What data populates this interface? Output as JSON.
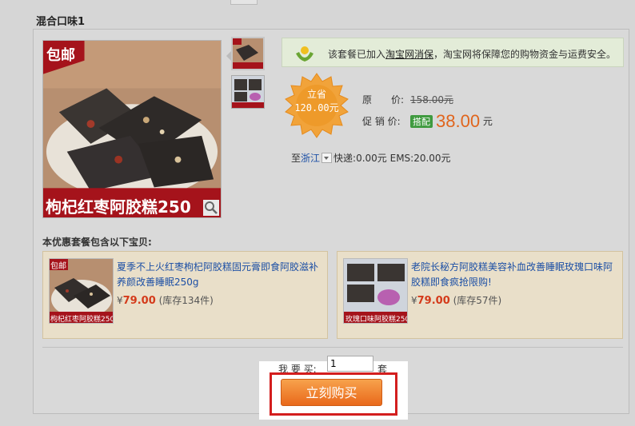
{
  "package": {
    "title": "混合口味1",
    "main_image": {
      "badge": "包邮",
      "caption": "枸杞红枣阿胶糕250"
    },
    "thumbnails": [
      {
        "name": "thumb-1"
      },
      {
        "name": "thumb-2"
      }
    ]
  },
  "notice": {
    "prefix": "该套餐已加入",
    "link": "淘宝网消保",
    "suffix": "，淘宝网将保障您的购物资金与运费安全。"
  },
  "savings": {
    "line1": "立省",
    "line2": "120.00元"
  },
  "prices": {
    "original_label": "原　　价:",
    "original_value": "158.00元",
    "promo_label": "促 销 价:",
    "promo_tag": "搭配",
    "promo_value": "38.00",
    "promo_unit": "元"
  },
  "shipping": {
    "to": "至",
    "region": "浙江",
    "details": "快递:0.00元 EMS:20.00元"
  },
  "includes": {
    "label": "本优惠套餐包含以下宝贝:",
    "items": [
      {
        "badge": "包邮",
        "img_caption": "枸杞红枣阿胶糕250g",
        "title": "夏季不上火红枣枸杞阿胶糕固元膏即食阿胶滋补养颜改善睡眠250g",
        "currency": "¥",
        "price": "79.00",
        "stock": "(库存134件)"
      },
      {
        "badge": "",
        "img_caption": "玫瑰口味阿胶糕250g",
        "title": "老院长秘方阿胶糕美容补血改善睡眠玫瑰口味阿胶糕即食疯抢限购!",
        "currency": "¥",
        "price": "79.00",
        "stock": "(库存57件)"
      }
    ]
  },
  "purchase": {
    "qty_label": "我 要 买:",
    "qty_value": "1",
    "qty_unit": "套",
    "buy_label": "立刻购买"
  },
  "colors": {
    "accent_orange": "#e0651d",
    "link_blue": "#1c4fa5",
    "highlight_red": "#d31e1e"
  }
}
